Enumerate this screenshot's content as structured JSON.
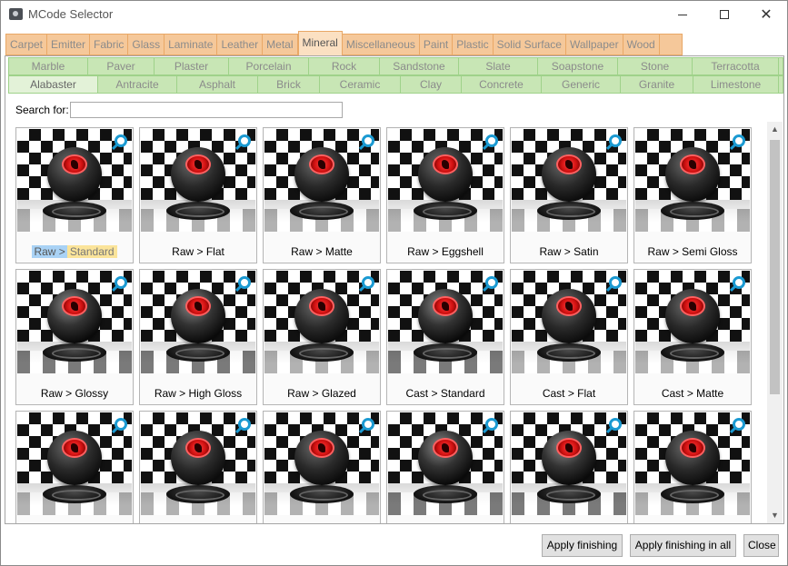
{
  "window": {
    "title": "MCode Selector"
  },
  "categories": {
    "tabs": [
      "Carpet",
      "Emitter",
      "Fabric",
      "Glass",
      "Laminate",
      "Leather",
      "Metal",
      "Mineral",
      "Miscellaneous",
      "Paint",
      "Plastic",
      "Solid Surface",
      "Wallpaper",
      "Wood"
    ],
    "active": "Mineral"
  },
  "subcategories": {
    "row1": [
      "Marble",
      "Paver",
      "Plaster",
      "Porcelain",
      "Rock",
      "Sandstone",
      "Slate",
      "Soapstone",
      "Stone",
      "Terracotta"
    ],
    "row2": [
      "Alabaster",
      "Antracite",
      "Asphalt",
      "Brick",
      "Ceramic",
      "Clay",
      "Concrete",
      "Generic",
      "Granite",
      "Limestone"
    ],
    "active": "Alabaster"
  },
  "search": {
    "label": "Search for:",
    "value": ""
  },
  "tiles": [
    {
      "label": "Raw > Standard",
      "parts": [
        "Raw >",
        "Standard"
      ]
    },
    {
      "label": "Raw > Flat"
    },
    {
      "label": "Raw > Matte"
    },
    {
      "label": "Raw > Eggshell"
    },
    {
      "label": "Raw > Satin"
    },
    {
      "label": "Raw > Semi Gloss"
    },
    {
      "label": "Raw > Glossy"
    },
    {
      "label": "Raw > High Gloss"
    },
    {
      "label": "Raw > Glazed"
    },
    {
      "label": "Cast > Standard"
    },
    {
      "label": "Cast > Flat"
    },
    {
      "label": "Cast > Matte"
    },
    {
      "label": ""
    },
    {
      "label": ""
    },
    {
      "label": ""
    },
    {
      "label": ""
    },
    {
      "label": ""
    },
    {
      "label": ""
    }
  ],
  "buttons": {
    "apply": "Apply finishing",
    "apply_all": "Apply finishing in all",
    "close": "Close"
  },
  "colors": {
    "category_bar": "#f5c89a",
    "subcategory_bar": "#c8e6b5",
    "zoom_icon": "#1b9ad2",
    "highlight_blue": "#a9d2f5",
    "highlight_yellow": "#fbe49a"
  },
  "icons": {
    "app": "camera-icon",
    "tile_zoom": "zoom-icon",
    "minimize": "minimize-icon",
    "maximize": "maximize-icon",
    "close": "close-icon"
  }
}
